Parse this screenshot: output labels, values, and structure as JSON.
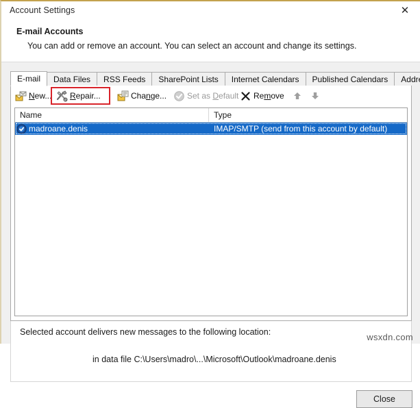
{
  "window": {
    "title": "Account Settings",
    "close_icon": "close-icon",
    "accent_border": "#c3a24e"
  },
  "header": {
    "title": "E-mail Accounts",
    "description": "You can add or remove an account. You can select an account and change its settings."
  },
  "tabs": [
    {
      "label": "E-mail",
      "active": true
    },
    {
      "label": "Data Files",
      "active": false
    },
    {
      "label": "RSS Feeds",
      "active": false
    },
    {
      "label": "SharePoint Lists",
      "active": false
    },
    {
      "label": "Internet Calendars",
      "active": false
    },
    {
      "label": "Published Calendars",
      "active": false
    },
    {
      "label": "Address Books",
      "active": false
    }
  ],
  "toolbar": {
    "new_label": "New...",
    "repair_label": "Repair...",
    "change_label": "Change...",
    "set_default_label": "Set as Default",
    "remove_label": "Remove",
    "move_up_icon": "arrow-up-icon",
    "move_down_icon": "arrow-down-icon",
    "highlight_color": "#d8232a",
    "highlighted_item": "Repair..."
  },
  "account_list": {
    "columns": [
      "Name",
      "Type"
    ],
    "rows": [
      {
        "icon": "account-check-icon",
        "name": "madroane.denis",
        "type": "IMAP/SMTP (send from this account by default)",
        "selected": true
      }
    ],
    "selection_color": "#1569c7"
  },
  "delivery": {
    "label": "Selected account delivers new messages to the following location:",
    "path": "in data file C:\\Users\\madro\\...\\Microsoft\\Outlook\\madroane.denis"
  },
  "footer": {
    "close_label": "Close"
  },
  "watermark": {
    "text": "wsxdn.com"
  }
}
